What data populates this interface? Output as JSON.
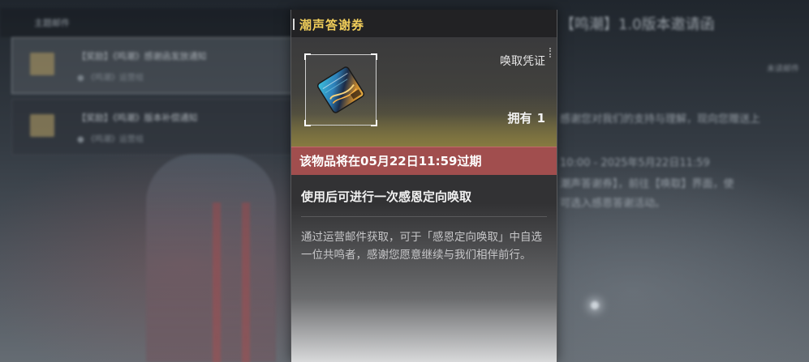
{
  "background": {
    "header_label": "主题邮件",
    "mail_items": [
      {
        "title": "【奖励】《鸣潮》感谢函发放通知",
        "subtitle": "● 《鸣潮》运营组"
      },
      {
        "title": "【奖励】《鸣潮》版本补偿通知",
        "subtitle": "● 《鸣潮》运营组"
      }
    ],
    "right_title": "【鸣潮】1.0版本邀请函",
    "right_badge": "未读邮件",
    "right_lines": [
      "感谢您对我们的支持与理解，现向您赠送上",
      "10:00 - 2025年5月22日11:59",
      "潮声答谢券】，前往【唤取】界面，使",
      "可选入感恩答谢活动。"
    ]
  },
  "tooltip": {
    "title": "潮声答谢券",
    "item_type": "唤取凭证",
    "owned_label": "拥有",
    "owned_count": "1",
    "expire_text": "该物品将在05月22日11:59过期",
    "effect_text": "使用后可进行一次感恩定向唤取",
    "description": "通过运营邮件获取，可于「感恩定向唤取」中自选一位共鸣者，感谢您愿意继续与我们相伴前行。"
  },
  "colors": {
    "title_gold": "#f0cd5a",
    "expire_red": "#a14e4e"
  }
}
